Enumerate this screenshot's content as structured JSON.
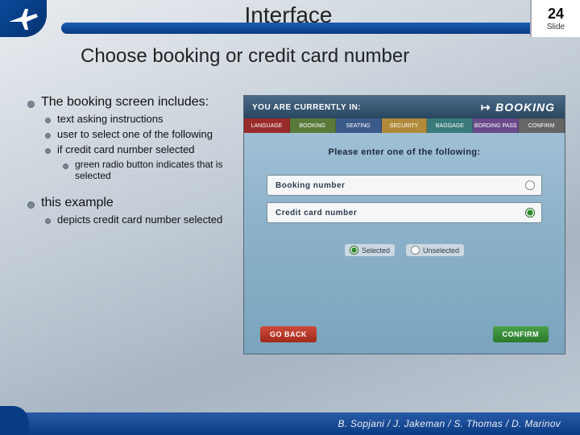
{
  "slide": {
    "title": "Interface",
    "number": "24",
    "number_label": "Slide",
    "subtitle": "Choose booking or credit card number"
  },
  "content": {
    "p1": "The booking screen includes:",
    "p1_items": [
      "text asking instructions",
      "user to select one of the following",
      "if credit card number selected"
    ],
    "p1_sub": "green radio button indicates that is selected",
    "p2": "this example",
    "p2_items": [
      "depicts credit card number selected"
    ]
  },
  "mock": {
    "status_prefix": "YOU ARE CURRENTLY IN:",
    "status_mode": "BOOKING",
    "tabs": [
      "LANGUAGE",
      "BOOKING",
      "SEATING",
      "SECURITY",
      "BAGGAGE",
      "BORDING PASS",
      "CONFIRM"
    ],
    "prompt": "Please enter one of the following:",
    "option1": "Booking number",
    "option2": "Credit card number",
    "legend_sel": "Selected",
    "legend_unsel": "Unselected",
    "btn_back": "GO BACK",
    "btn_confirm": "CONFIRM"
  },
  "footer": {
    "authors": "B. Sopjani / J. Jakeman / S. Thomas / D. Marinov"
  }
}
